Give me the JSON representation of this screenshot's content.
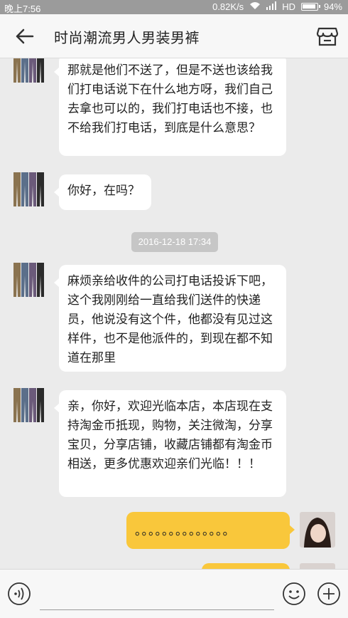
{
  "status_bar": {
    "time": "晚上7:56",
    "speed": "0.82K/s",
    "network": "HD",
    "battery": "94%",
    "battery_level": 0.94
  },
  "header": {
    "title": "时尚潮流男人男装男裤",
    "back_icon": "arrow-left-icon",
    "shop_icon": "store-icon"
  },
  "messages": [
    {
      "sender": "shop",
      "text": "那就是他们不送了，但是不送也该给我们打电话说下在什么地方呀，我们自己去拿也可以的，我们打电话也不接，也不给我们打电话，到底是什么意思？"
    },
    {
      "sender": "shop",
      "text": "你好，在吗？"
    },
    {
      "sender": "shop",
      "text": "麻烦亲给收件的公司打电话投诉下吧，这个我刚刚给一直给我们送件的快递员，他说没有这个件，他都没有见过这样件，也不是他派件的，到现在都不知道在那里"
    },
    {
      "sender": "shop",
      "text": "亲，你好，欢迎光临本店，本店现在支持淘金币抵现，购物，关注微淘，分享宝贝，分享店铺，收藏店铺都有淘金币相送，更多优惠欢迎亲们光临！！！"
    },
    {
      "sender": "user",
      "text": "。。。。。。。。。。。。。。"
    }
  ],
  "timestamp": "2016-12-18 17:34",
  "colors": {
    "user_bubble": "#f9c73b",
    "shop_bubble": "#ffffff",
    "background": "#ebebeb"
  },
  "input_bar": {
    "voice_icon": "voice-icon",
    "emoji_icon": "emoji-icon",
    "plus_icon": "plus-icon"
  }
}
